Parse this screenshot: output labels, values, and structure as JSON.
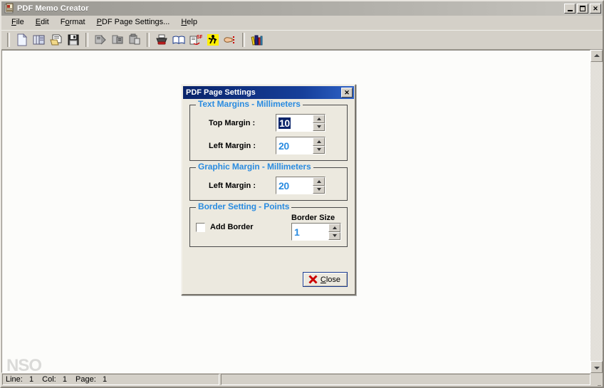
{
  "window": {
    "title": "PDF Memo Creator",
    "icon": "app-icon",
    "controls": {
      "minimize": "Minimize",
      "maximize": "Maximize",
      "close": "Close"
    }
  },
  "menubar": {
    "items": [
      {
        "label": "File",
        "accel": "F"
      },
      {
        "label": "Edit",
        "accel": "E"
      },
      {
        "label": "Format",
        "accel": "o"
      },
      {
        "label": "PDF Page Settings...",
        "accel": "P"
      },
      {
        "label": "Help",
        "accel": "H"
      }
    ]
  },
  "toolbar": {
    "groups": [
      {
        "buttons": [
          {
            "name": "new-document-icon",
            "title": "New"
          },
          {
            "name": "copy-pages-icon",
            "title": "Copy"
          },
          {
            "name": "open-folder-icon",
            "title": "Open"
          },
          {
            "name": "save-floppy-icon",
            "title": "Save"
          }
        ]
      },
      {
        "buttons": [
          {
            "name": "cut-icon",
            "title": "Cut"
          },
          {
            "name": "copy-icon",
            "title": "Copy"
          },
          {
            "name": "paste-icon",
            "title": "Paste"
          }
        ]
      },
      {
        "buttons": [
          {
            "name": "print-icon",
            "title": "Print"
          },
          {
            "name": "book-icon",
            "title": "Preview"
          },
          {
            "name": "spellcheck-icon",
            "title": "Spell Check"
          },
          {
            "name": "run-person-icon",
            "title": "Run"
          },
          {
            "name": "pointing-hand-icon",
            "title": "Select"
          }
        ]
      },
      {
        "buttons": [
          {
            "name": "library-books-icon",
            "title": "Library"
          }
        ]
      }
    ]
  },
  "editor": {
    "watermark": "NSO",
    "content": ""
  },
  "scrollbar": {
    "up_arrow": "scroll-up",
    "down_arrow": "scroll-down"
  },
  "statusbar": {
    "line_label": "Line:",
    "line_value": "1",
    "col_label": "Col:",
    "col_value": "1",
    "page_label": "Page:",
    "page_value": "1",
    "right_pane": ""
  },
  "dialog": {
    "title": "PDF Page Settings",
    "close_box": "✕",
    "groups": [
      {
        "id": "text-margins",
        "legend": "Text Margins - Millimeters",
        "fields": [
          {
            "label": "Top Margin :",
            "value": "10",
            "selected": true
          },
          {
            "label": "Left Margin :",
            "value": "20",
            "selected": false
          }
        ]
      },
      {
        "id": "graphic-margin",
        "legend": "Graphic Margin - Millimeters",
        "fields": [
          {
            "label": "Left Margin :",
            "value": "20",
            "selected": false
          }
        ]
      },
      {
        "id": "border-setting",
        "legend": "Border Setting - Points",
        "checkbox": {
          "label": "Add Border",
          "checked": false
        },
        "border_size": {
          "caption": "Border Size",
          "value": "1",
          "selected": false
        }
      }
    ],
    "close_button": {
      "label_prefix": "",
      "accel": "C",
      "label_rest": "lose",
      "icon": "red-x-icon"
    }
  },
  "colors": {
    "accent_blue": "#2b8ce0",
    "dialog_titlebar": "#0a246a",
    "dialog_face": "#ece9df",
    "window_face": "#d4d0c8",
    "selection": "#0a246a",
    "close_x_red": "#cc0000"
  }
}
